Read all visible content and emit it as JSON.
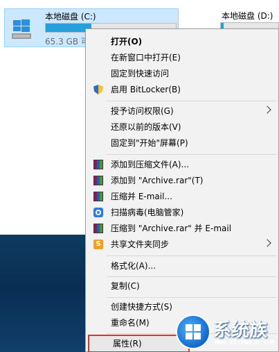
{
  "drives": [
    {
      "name": "本地磁盘 (C:)",
      "free_text": "65.3 GB 可",
      "used_fraction": 0.35
    },
    {
      "name": "本地磁盘 (D:)",
      "used_fraction": 0.05
    }
  ],
  "context_menu": {
    "items": [
      {
        "label": "打开(O)",
        "bold": true
      },
      {
        "label": "在新窗口中打开(E)"
      },
      {
        "label": "固定到快速访问"
      },
      {
        "label": "启用 BitLocker(B)",
        "icon": "shield-icon"
      },
      {
        "label": "授予访问权限(G)",
        "submenu": true
      },
      {
        "label": "还原以前的版本(V)"
      },
      {
        "label": "固定到\"开始\"屏幕(P)"
      },
      {
        "label": "添加到压缩文件(A)...",
        "icon": "winrar-icon"
      },
      {
        "label": "添加到 \"Archive.rar\"(T)",
        "icon": "winrar-icon"
      },
      {
        "label": "压缩并 E-mail...",
        "icon": "winrar-icon"
      },
      {
        "label": "扫描病毒(电脑管家)",
        "icon": "pc-manager-icon"
      },
      {
        "label": "压缩到 \"Archive.rar\" 并 E-mail",
        "icon": "winrar-icon"
      },
      {
        "label": "共享文件夹同步",
        "icon": "sync-icon",
        "submenu": true
      },
      {
        "label": "格式化(A)..."
      },
      {
        "label": "复制(C)"
      },
      {
        "label": "创建快捷方式(S)"
      },
      {
        "label": "重命名(M)"
      },
      {
        "label": "属性(R)",
        "highlighted": true
      }
    ]
  },
  "watermark": {
    "title": "系统族",
    "url": "WWW.XITONGZU.COM"
  }
}
